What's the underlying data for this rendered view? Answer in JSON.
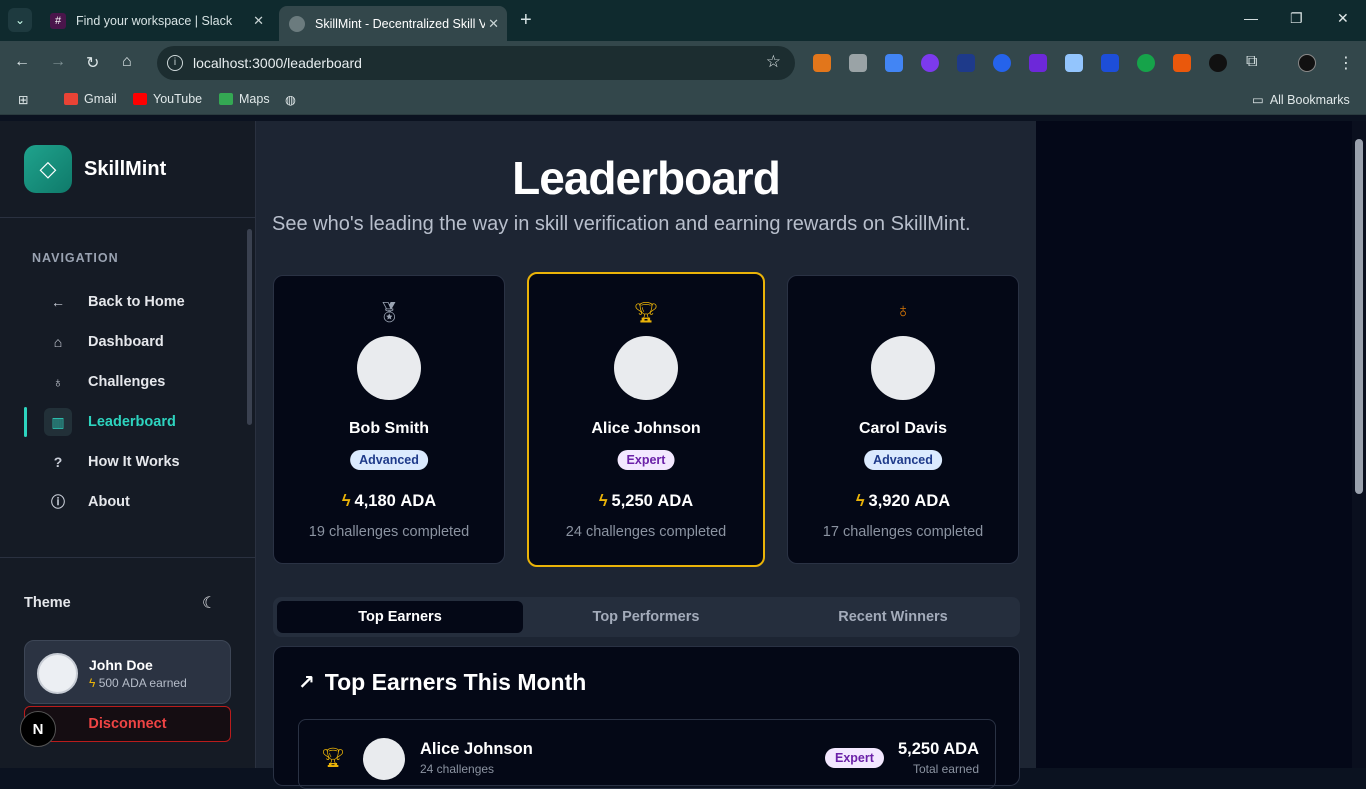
{
  "browser": {
    "tabs": [
      {
        "title": "Find your workspace | Slack",
        "icon": "slack-icon"
      },
      {
        "title": "SkillMint - Decentralized Skill V",
        "icon": "globe-icon"
      }
    ],
    "url": "localhost:3000/leaderboard",
    "bookmarks": [
      "Gmail",
      "YouTube",
      "Maps"
    ],
    "all_bookmarks": "All Bookmarks"
  },
  "sidebar": {
    "brand": "SkillMint",
    "nav_title": "NAVIGATION",
    "items": [
      {
        "label": "Back to Home",
        "icon": "arrow-left-icon"
      },
      {
        "label": "Dashboard",
        "icon": "home-icon"
      },
      {
        "label": "Challenges",
        "icon": "award-icon"
      },
      {
        "label": "Leaderboard",
        "icon": "bar-chart-icon",
        "active": true
      },
      {
        "label": "How It Works",
        "icon": "help-circle-icon"
      },
      {
        "label": "About",
        "icon": "info-icon"
      }
    ],
    "theme_label": "Theme",
    "user": {
      "name": "John Doe",
      "earned": "500 ADA earned"
    },
    "disconnect": "Disconnect",
    "badge": "N"
  },
  "main": {
    "title": "Leaderboard",
    "subtitle": "See who's leading the way in skill verification and earning rewards on SkillMint.",
    "podium": [
      {
        "name": "Bob Smith",
        "level": "Advanced",
        "ada": "4,180 ADA",
        "challenges": "19 challenges completed",
        "medal_color": "#9aa3b2",
        "medal": "medal-icon"
      },
      {
        "name": "Alice Johnson",
        "level": "Expert",
        "ada": "5,250 ADA",
        "challenges": "24 challenges completed",
        "medal_color": "#eab308",
        "medal": "trophy-icon"
      },
      {
        "name": "Carol Davis",
        "level": "Advanced",
        "ada": "3,920 ADA",
        "challenges": "17 challenges completed",
        "medal_color": "#d97706",
        "medal": "award-icon"
      }
    ],
    "tabs": [
      "Top Earners",
      "Top Performers",
      "Recent Winners"
    ],
    "active_tab": "Top Earners",
    "panel_title": "Top Earners This Month",
    "rows": [
      {
        "name": "Alice Johnson",
        "sub": "24 challenges",
        "level": "Expert",
        "ada": "5,250 ADA",
        "ada_sub": "Total earned"
      }
    ]
  }
}
